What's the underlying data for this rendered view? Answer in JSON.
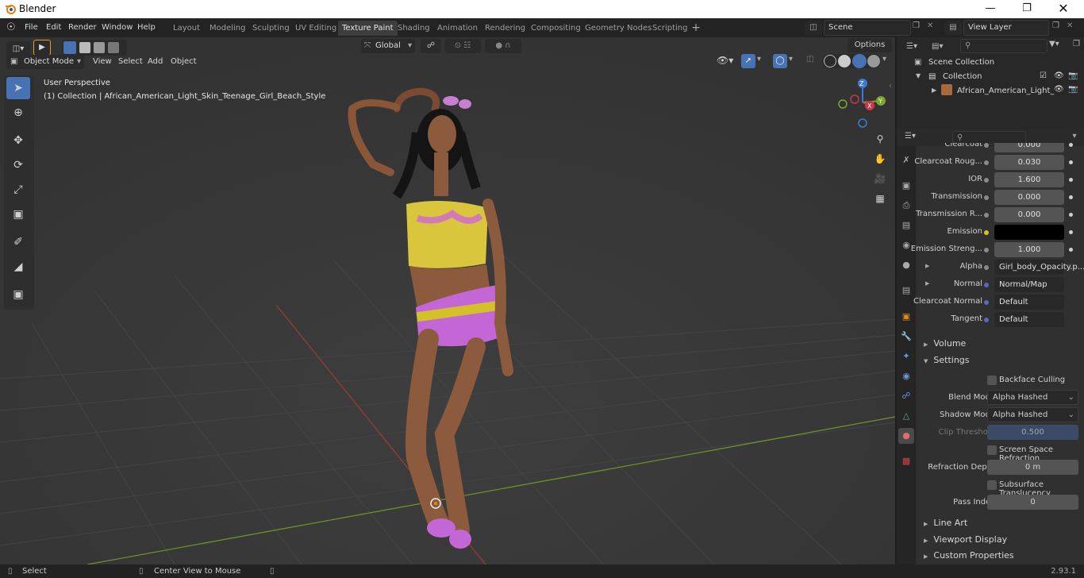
{
  "app": {
    "title": "Blender",
    "version": "2.93.1"
  },
  "menus": [
    "File",
    "Edit",
    "Render",
    "Window",
    "Help"
  ],
  "workspaces": [
    {
      "label": "Layout",
      "active": false
    },
    {
      "label": "Modeling",
      "active": false
    },
    {
      "label": "Sculpting",
      "active": false
    },
    {
      "label": "UV Editing",
      "active": false
    },
    {
      "label": "Texture Paint",
      "active": true
    },
    {
      "label": "Shading",
      "active": false
    },
    {
      "label": "Animation",
      "active": false
    },
    {
      "label": "Rendering",
      "active": false
    },
    {
      "label": "Compositing",
      "active": false
    },
    {
      "label": "Geometry Nodes",
      "active": false
    },
    {
      "label": "Scripting",
      "active": false
    }
  ],
  "scene": {
    "name": "Scene",
    "view_layer": "View Layer"
  },
  "viewport": {
    "transform_orientation": "Global",
    "options_label": "Options",
    "mode": "Object Mode",
    "header_menus": [
      "View",
      "Select",
      "Add",
      "Object"
    ],
    "overlay_title": "User Perspective",
    "overlay_subtitle": "(1) Collection | African_American_Light_Skin_Teenage_Girl_Beach_Style",
    "axes": {
      "x": "X",
      "y": "Y",
      "z": "Z"
    }
  },
  "outliner": {
    "root": "Scene Collection",
    "collection": "Collection",
    "object": "African_American_Light_"
  },
  "properties": {
    "inputs": [
      {
        "label": "Clearcoat",
        "value": "0.000",
        "socket": "#8a8a8a"
      },
      {
        "label": "Clearcoat Roug...",
        "value": "0.030",
        "socket": "#8a8a8a"
      },
      {
        "label": "IOR",
        "value": "1.600",
        "socket": "#8a8a8a"
      },
      {
        "label": "Transmission",
        "value": "0.000",
        "socket": "#8a8a8a"
      },
      {
        "label": "Transmission R...",
        "value": "0.000",
        "socket": "#8a8a8a"
      },
      {
        "label": "Emission",
        "value": "",
        "socket": "#c7c729",
        "color": "#000000"
      },
      {
        "label": "Emission Streng...",
        "value": "1.000",
        "socket": "#8a8a8a"
      },
      {
        "label": "Alpha",
        "value": "Girl_body_Opacity.p...",
        "socket": "#8a8a8a"
      },
      {
        "label": "Normal",
        "value": "Normal/Map",
        "socket": "#6363c7"
      },
      {
        "label": "Clearcoat Normal",
        "value": "Default",
        "socket": "#6363c7"
      },
      {
        "label": "Tangent",
        "value": "Default",
        "socket": "#6363c7"
      }
    ],
    "panels": {
      "volume": "Volume",
      "settings": "Settings",
      "line_art": "Line Art",
      "viewport_display": "Viewport Display",
      "custom_properties": "Custom Properties"
    },
    "settings": {
      "backface_culling": "Backface Culling",
      "blend_mode_label": "Blend Mode",
      "blend_mode": "Alpha Hashed",
      "shadow_mode_label": "Shadow Mode",
      "shadow_mode": "Alpha Hashed",
      "clip_threshold_label": "Clip Threshold",
      "clip_threshold": "0.500",
      "screen_space_refraction": "Screen Space Refraction",
      "refraction_depth_label": "Refraction Depth",
      "refraction_depth": "0 m",
      "subsurface_translucency": "Subsurface Translucency",
      "pass_index_label": "Pass Index",
      "pass_index": "0"
    }
  },
  "status": {
    "select": "Select",
    "center_view": "Center View to Mouse"
  },
  "colors": {
    "accent": "#4772b3",
    "x_axis": "#c9384a",
    "y_axis": "#7aa62a",
    "z_axis": "#3d7ad6"
  }
}
